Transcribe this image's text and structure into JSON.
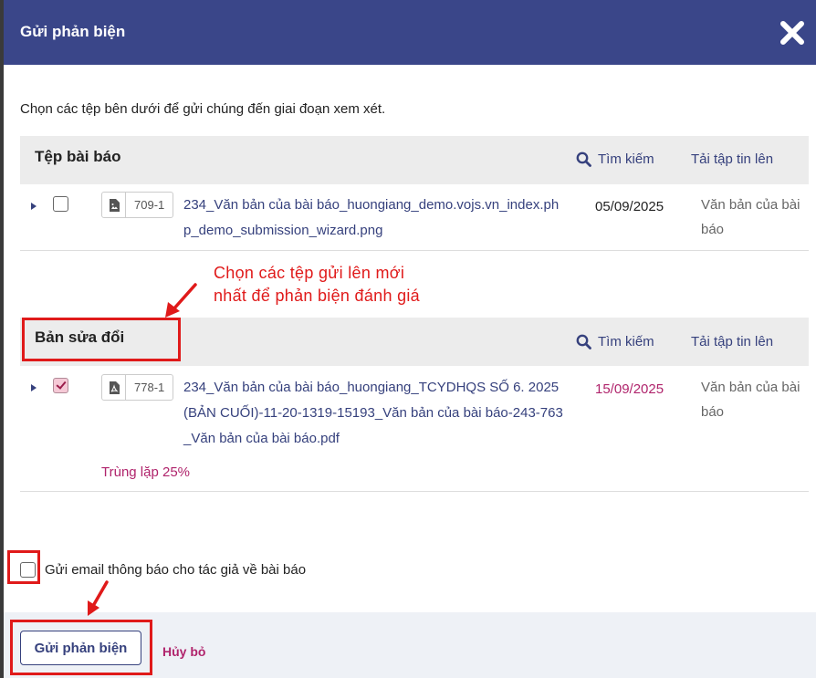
{
  "modal": {
    "title": "Gửi phản biện",
    "intro": "Chọn các tệp bên dưới để gửi chúng đến giai đoạn xem xét."
  },
  "article_files": {
    "title": "Tệp bài báo",
    "search_label": "Tìm kiếm",
    "upload_label": "Tải tập tin lên",
    "rows": [
      {
        "id": "709-1",
        "name": "234_Văn bản của bài báo_huongiang_demo.vojs.vn_index.php_demo_submission_wizard.png",
        "date": "05/09/2025",
        "type": "Văn bản của bài báo",
        "checked": false,
        "icon": "image-file-icon"
      }
    ]
  },
  "revisions": {
    "title": "Bản sửa đổi",
    "search_label": "Tìm kiếm",
    "upload_label": "Tải tập tin lên",
    "rows": [
      {
        "id": "778-1",
        "name": "234_Văn bản của bài báo_huongiang_TCYDHQS SỐ 6. 2025 (BẢN CUỐI)-11-20-1319-15193_Văn bản của bài báo-243-763_Văn bản của bài báo.pdf",
        "date": "15/09/2025",
        "type": "Văn bản của bài báo",
        "checked": true,
        "duplicate": "Trùng lặp 25%",
        "icon": "pdf-file-icon"
      }
    ]
  },
  "annotation": {
    "line1": "Chọn các tệp gửi lên mới",
    "line2": "nhất để phản biện đánh giá"
  },
  "email_option": {
    "label": "Gửi email thông báo cho tác giả về bài báo",
    "checked": false
  },
  "footer": {
    "submit_label": "Gửi phản biện",
    "cancel_label": "Hủy bỏ"
  },
  "colors": {
    "header_bg": "#3a4689",
    "link": "#36417d",
    "accent_pink": "#b0246c",
    "annotation_red": "#e01a1a",
    "footer_bg": "#eef1f6"
  }
}
